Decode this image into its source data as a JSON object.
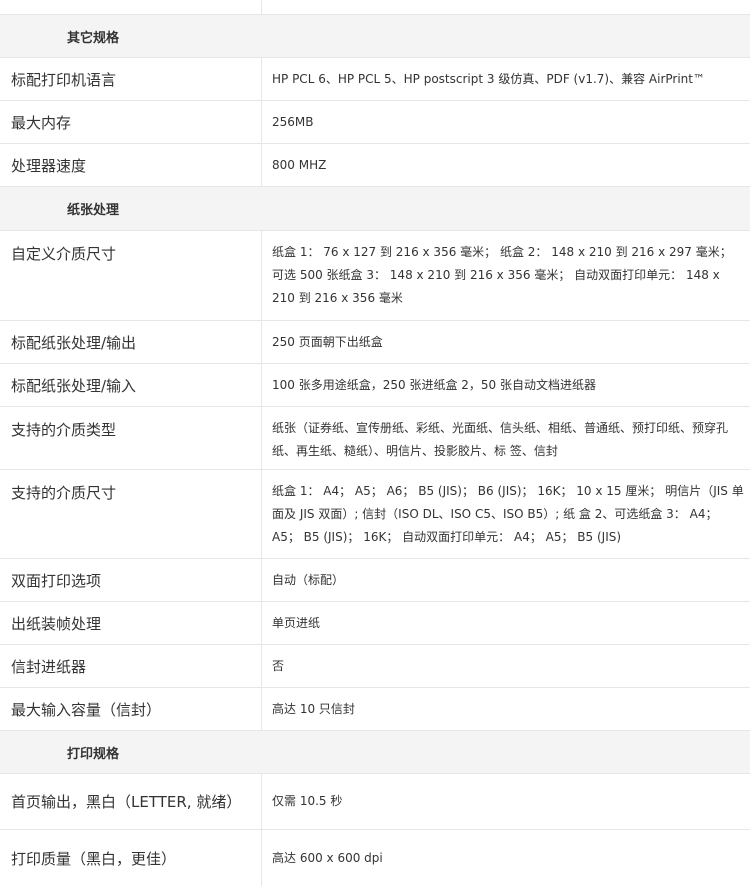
{
  "sections": [
    {
      "title": "其它规格",
      "rows": [
        {
          "label": "标配打印机语言",
          "value": "HP PCL 6、HP PCL 5、HP postscript 3 级仿真、PDF (v1.7)、兼容 AirPrint™"
        },
        {
          "label": "最大内存",
          "value": "256MB"
        },
        {
          "label": "处理器速度",
          "value": "800 MHZ"
        }
      ]
    },
    {
      "title": "纸张处理",
      "rows": [
        {
          "label": "自定义介质尺寸",
          "value": "纸盒 1： 76 x 127 到 216 x 356 毫米； 纸盒 2： 148 x 210 到 216 x 297 毫米； 可选 500 张纸盒 3： 148 x 210 到 216 x 356 毫米； 自动双面打印单元： 148 x 210 到 216 x 356 毫米"
        },
        {
          "label": "标配纸张处理/输出",
          "value": "250 页面朝下出纸盒"
        },
        {
          "label": "标配纸张处理/输入",
          "value": "100 张多用途纸盒，250 张进纸盒 2，50 张自动文档进纸器"
        },
        {
          "label": "支持的介质类型",
          "value": "纸张（证券纸、宣传册纸、彩纸、光面纸、信头纸、相纸、普通纸、预打印纸、预穿孔纸、再生纸、糙纸）、明信片、投影胶片、标 签、信封"
        },
        {
          "label": "支持的介质尺寸",
          "value": "纸盒 1： A4； A5； A6； B5 (JIS)； B6 (JIS)； 16K； 10 x 15 厘米； 明信片（JIS 单面及 JIS 双面）; 信封（ISO DL、ISO C5、ISO B5）; 纸 盒 2、可选纸盒 3： A4； A5； B5 (JIS)； 16K； 自动双面打印单元： A4； A5； B5 (JIS)"
        },
        {
          "label": "双面打印选项",
          "value": "自动（标配）"
        },
        {
          "label": "出纸装帧处理",
          "value": "单页进纸"
        },
        {
          "label": "信封进纸器",
          "value": "否"
        },
        {
          "label": "最大输入容量（信封）",
          "value": "高达 10 只信封"
        }
      ]
    },
    {
      "title": "打印规格",
      "rows": [
        {
          "label": "首页输出，黑白（LETTER, 就绪）",
          "value": "仅需 10.5 秒"
        },
        {
          "label": "打印质量（黑白，更佳）",
          "value": "高达 600 x 600 dpi"
        }
      ]
    }
  ]
}
